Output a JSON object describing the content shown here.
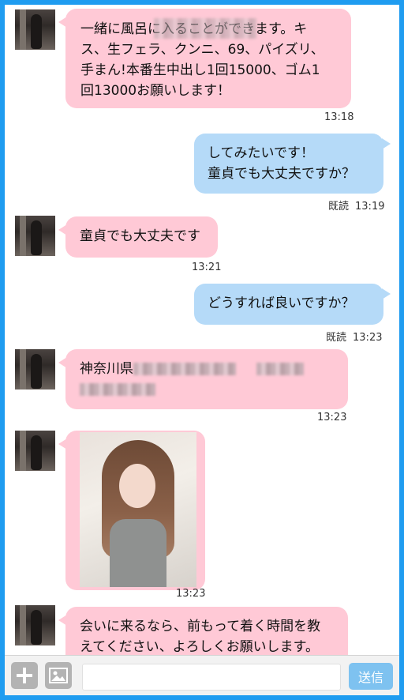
{
  "messages": [
    {
      "lines": [
        "一緒に風呂に入ることができます。キ",
        "ス、生フェラ、クンニ、69、パイズリ、",
        "手まん!本番生中出し1回15000、ゴム1",
        "回13000お願いします！"
      ],
      "time": "13:18"
    },
    {
      "lines": [
        "してみたいです！",
        "童貞でも大丈夫ですか？"
      ],
      "read": "既読",
      "time": "13:19"
    },
    {
      "lines": [
        "童貞でも大丈夫です"
      ],
      "time": "13:21"
    },
    {
      "lines": [
        "どうすれば良いですか？"
      ],
      "read": "既読",
      "time": "13:23"
    },
    {
      "prefix": "神奈川県",
      "time": "13:23"
    },
    {
      "type": "image",
      "time": "13:23"
    },
    {
      "lines": [
        "会いに来るなら、前もって着く時間を教",
        "えてください、よろしくお願いします。"
      ]
    }
  ],
  "input_bar": {
    "send_label": "送信",
    "icons": [
      "plus-icon",
      "image-icon"
    ]
  },
  "colors": {
    "frame": "#1f9cf0",
    "incoming_bubble": "#ffc9d6",
    "outgoing_bubble": "#b5daf8",
    "send_button": "#7ec2f0"
  }
}
